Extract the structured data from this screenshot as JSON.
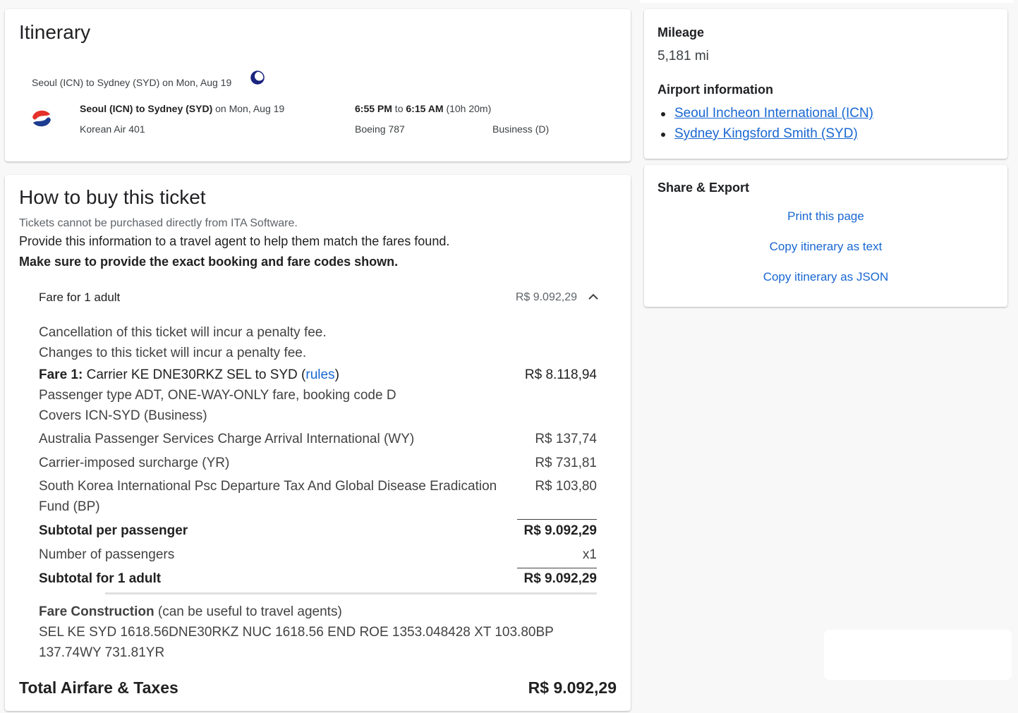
{
  "itinerary": {
    "title": "Itinerary",
    "segment_header": "Seoul (ICN) to Sydney (SYD) on Mon, Aug 19",
    "route_bold": "Seoul (ICN) to Sydney (SYD)",
    "route_date": " on Mon, Aug 19",
    "depart_time": "6:55 PM",
    "times_to": " to ",
    "arrive_time": "6:15 AM",
    "duration": " (10h 20m)",
    "flight": "Korean Air 401",
    "aircraft": "Boeing 787",
    "cabin": "Business (D)",
    "icons": {
      "overnight": "moon-icon",
      "airline": "korean-air-logo"
    }
  },
  "buy": {
    "title": "How to buy this ticket",
    "note1": "Tickets cannot be purchased directly from ITA Software.",
    "note2": "Provide this information to a travel agent to help them match the fares found.",
    "note3": "Make sure to provide the exact booking and fare codes shown.",
    "fare_header": {
      "label": "Fare for 1 adult",
      "amount": "R$ 9.092,29"
    },
    "penalty1": "Cancellation of this ticket will incur a penalty fee.",
    "penalty2": "Changes to this ticket will incur a penalty fee.",
    "fare1": {
      "label": "Fare 1:",
      "desc": " Carrier KE DNE30RKZ SEL to SYD (",
      "rules_link": "rules",
      "close_paren": ")",
      "amount": "R$ 8.118,94",
      "line2": "Passenger type ADT, ONE-WAY-ONLY fare, booking code D",
      "line3": "Covers ICN-SYD (Business)"
    },
    "taxes": [
      {
        "label": "Australia Passenger Services Charge Arrival International (WY)",
        "amount": "R$ 137,74"
      },
      {
        "label": "Carrier-imposed surcharge (YR)",
        "amount": "R$ 731,81"
      },
      {
        "label": "South Korea International Psc Departure Tax And Global Disease Eradication",
        "label2": "Fund (BP)",
        "amount": "R$ 103,80"
      }
    ],
    "subtotal_pp": {
      "label": "Subtotal per passenger",
      "amount": "R$ 9.092,29"
    },
    "num_passengers": {
      "label": "Number of passengers",
      "amount": "x1"
    },
    "subtotal_adult": {
      "label": "Subtotal for 1 adult",
      "amount": "R$ 9.092,29"
    },
    "fare_construction": {
      "label": "Fare Construction",
      "hint": " (can be useful to travel agents)",
      "line1": "SEL KE SYD 1618.56DNE30RKZ NUC 1618.56 END ROE 1353.048428 XT 103.80BP",
      "line2": "137.74WY 731.81YR"
    },
    "total": {
      "label": "Total Airfare & Taxes",
      "amount": "R$ 9.092,29"
    }
  },
  "mileage": {
    "heading": "Mileage",
    "value": "5,181 mi",
    "airport_heading": "Airport information",
    "airports": [
      "Seoul Incheon International (ICN)",
      "Sydney Kingsford Smith (SYD)"
    ]
  },
  "share": {
    "heading": "Share & Export",
    "links": [
      "Print this page",
      "Copy itinerary as text",
      "Copy itinerary as JSON"
    ]
  }
}
